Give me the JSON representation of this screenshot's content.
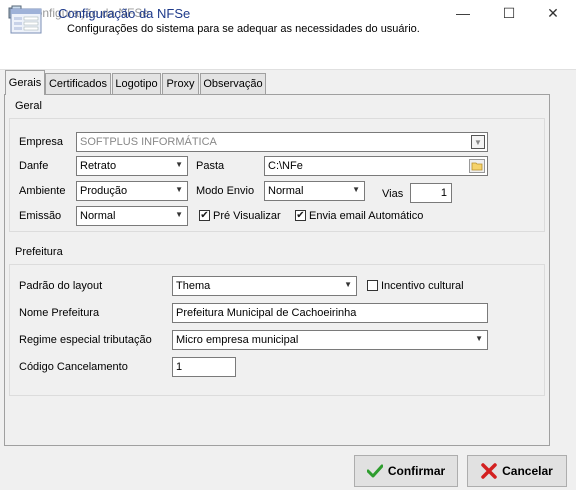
{
  "window": {
    "title": "Configuração da NFSe",
    "controls": {
      "minimize": "—",
      "maximize": "☐",
      "close": "✕"
    }
  },
  "header": {
    "title": "Configuração da NFSe",
    "subtitle": "Configurações do sistema para se adequar as necessidades do usuário."
  },
  "tabs": [
    {
      "label": "Gerais",
      "active": true
    },
    {
      "label": "Certificados",
      "active": false
    },
    {
      "label": "Logotipo",
      "active": false
    },
    {
      "label": "Proxy",
      "active": false
    },
    {
      "label": "Observação",
      "active": false
    }
  ],
  "geral": {
    "group_label": "Geral",
    "empresa_label": "Empresa",
    "empresa_value": "SOFTPLUS INFORMÁTICA",
    "danfe_label": "Danfe",
    "danfe_value": "Retrato",
    "pasta_label": "Pasta",
    "pasta_value": "C:\\NFe",
    "ambiente_label": "Ambiente",
    "ambiente_value": "Produção",
    "modo_envio_label": "Modo Envio",
    "modo_envio_value": "Normal",
    "vias_label": "Vias",
    "vias_value": "1",
    "emissao_label": "Emissão",
    "emissao_value": "Normal",
    "pre_visualizar_label": "Pré Visualizar",
    "pre_visualizar_checked": true,
    "envia_email_label": "Envia email Automático",
    "envia_email_checked": true
  },
  "prefeitura": {
    "group_label": "Prefeitura",
    "padrao_layout_label": "Padrão do layout",
    "padrao_layout_value": "Thema",
    "incentivo_label": "Incentivo cultural",
    "incentivo_checked": false,
    "nome_label": "Nome Prefeitura",
    "nome_value": "Prefeitura Municipal de Cachoeirinha",
    "regime_label": "Regime especial tributação",
    "regime_value": "Micro empresa municipal",
    "codigo_label": "Código Cancelamento",
    "codigo_value": "1"
  },
  "buttons": {
    "confirmar": "Confirmar",
    "cancelar": "Cancelar"
  },
  "colors": {
    "header_title": "#1e3a8a",
    "confirm_icon": "#2e9d2e",
    "cancel_icon": "#d32020"
  },
  "icons": {
    "app": "form-icon",
    "header": "form-icon",
    "folder": "folder-icon",
    "confirm": "checkmark-icon",
    "cancel": "x-icon"
  }
}
